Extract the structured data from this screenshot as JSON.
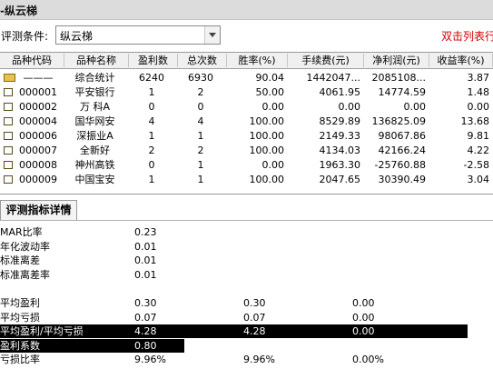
{
  "window": {
    "title": "-纵云梯"
  },
  "criteria": {
    "label": "评测条件:",
    "value": "纵云梯",
    "hint": "双击列表行"
  },
  "table": {
    "columns": [
      "品种代码",
      "品种名称",
      "盈利数",
      "总次数",
      "胜率(%)",
      "手续费(元)",
      "净利润(元)",
      "收益率(%)"
    ],
    "rows": [
      {
        "code": "———",
        "name": "综合统计",
        "wins": "6240",
        "total": "6930",
        "rate": "90.04",
        "fee": "1442047...",
        "profit": "2085108...",
        "ret": "3.87",
        "icon": "summary-folder-icon"
      },
      {
        "code": "000001",
        "name": "平安银行",
        "wins": "1",
        "total": "2",
        "rate": "50.00",
        "fee": "4061.95",
        "profit": "14774.59",
        "ret": "1.48",
        "icon": "folder-icon"
      },
      {
        "code": "000002",
        "name": "万 科A",
        "wins": "0",
        "total": "0",
        "rate": "0.00",
        "fee": "0.00",
        "profit": "0.00",
        "ret": "0.00",
        "icon": "folder-icon"
      },
      {
        "code": "000004",
        "name": "国华网安",
        "wins": "4",
        "total": "4",
        "rate": "100.00",
        "fee": "8529.89",
        "profit": "136825.09",
        "ret": "13.68",
        "icon": "folder-icon"
      },
      {
        "code": "000006",
        "name": "深振业A",
        "wins": "1",
        "total": "1",
        "rate": "100.00",
        "fee": "2149.33",
        "profit": "98067.86",
        "ret": "9.81",
        "icon": "folder-icon"
      },
      {
        "code": "000007",
        "name": "全新好",
        "wins": "2",
        "total": "2",
        "rate": "100.00",
        "fee": "4134.03",
        "profit": "42166.24",
        "ret": "4.22",
        "icon": "folder-icon"
      },
      {
        "code": "000008",
        "name": "神州高铁",
        "wins": "0",
        "total": "1",
        "rate": "0.00",
        "fee": "1963.30",
        "profit": "-25760.88",
        "ret": "-2.58",
        "icon": "folder-icon"
      },
      {
        "code": "000009",
        "name": "中国宝安",
        "wins": "1",
        "total": "1",
        "rate": "100.00",
        "fee": "2047.65",
        "profit": "30390.49",
        "ret": "3.04",
        "icon": "folder-icon"
      }
    ]
  },
  "details": {
    "tab_label": "评测指标详情",
    "rows": [
      {
        "label": "MAR比率",
        "v1": "0.23",
        "v2": "",
        "v3": "",
        "highlight": "none"
      },
      {
        "label": "年化波动率",
        "v1": "0.01",
        "v2": "",
        "v3": "",
        "highlight": "none"
      },
      {
        "label": "标准离差",
        "v1": "0.01",
        "v2": "",
        "v3": "",
        "highlight": "none"
      },
      {
        "label": "标准离差率",
        "v1": "0.01",
        "v2": "",
        "v3": "",
        "highlight": "none"
      },
      {
        "label": "",
        "v1": "",
        "v2": "",
        "v3": "",
        "highlight": "none"
      },
      {
        "label": "平均盈利",
        "v1": "0.30",
        "v2": "0.30",
        "v3": "0.00",
        "highlight": "none"
      },
      {
        "label": "平均亏损",
        "v1": "0.07",
        "v2": "0.07",
        "v3": "0.00",
        "highlight": "none"
      },
      {
        "label": "平均盈利/平均亏损",
        "v1": "4.28",
        "v2": "4.28",
        "v3": "0.00",
        "highlight": "wide"
      },
      {
        "label": "盈利系数",
        "v1": "0.80",
        "v2": "",
        "v3": "",
        "highlight": "short"
      },
      {
        "label": "亏损比率",
        "v1": "9.96%",
        "v2": "9.96%",
        "v3": "0.00%",
        "highlight": "none"
      }
    ]
  }
}
